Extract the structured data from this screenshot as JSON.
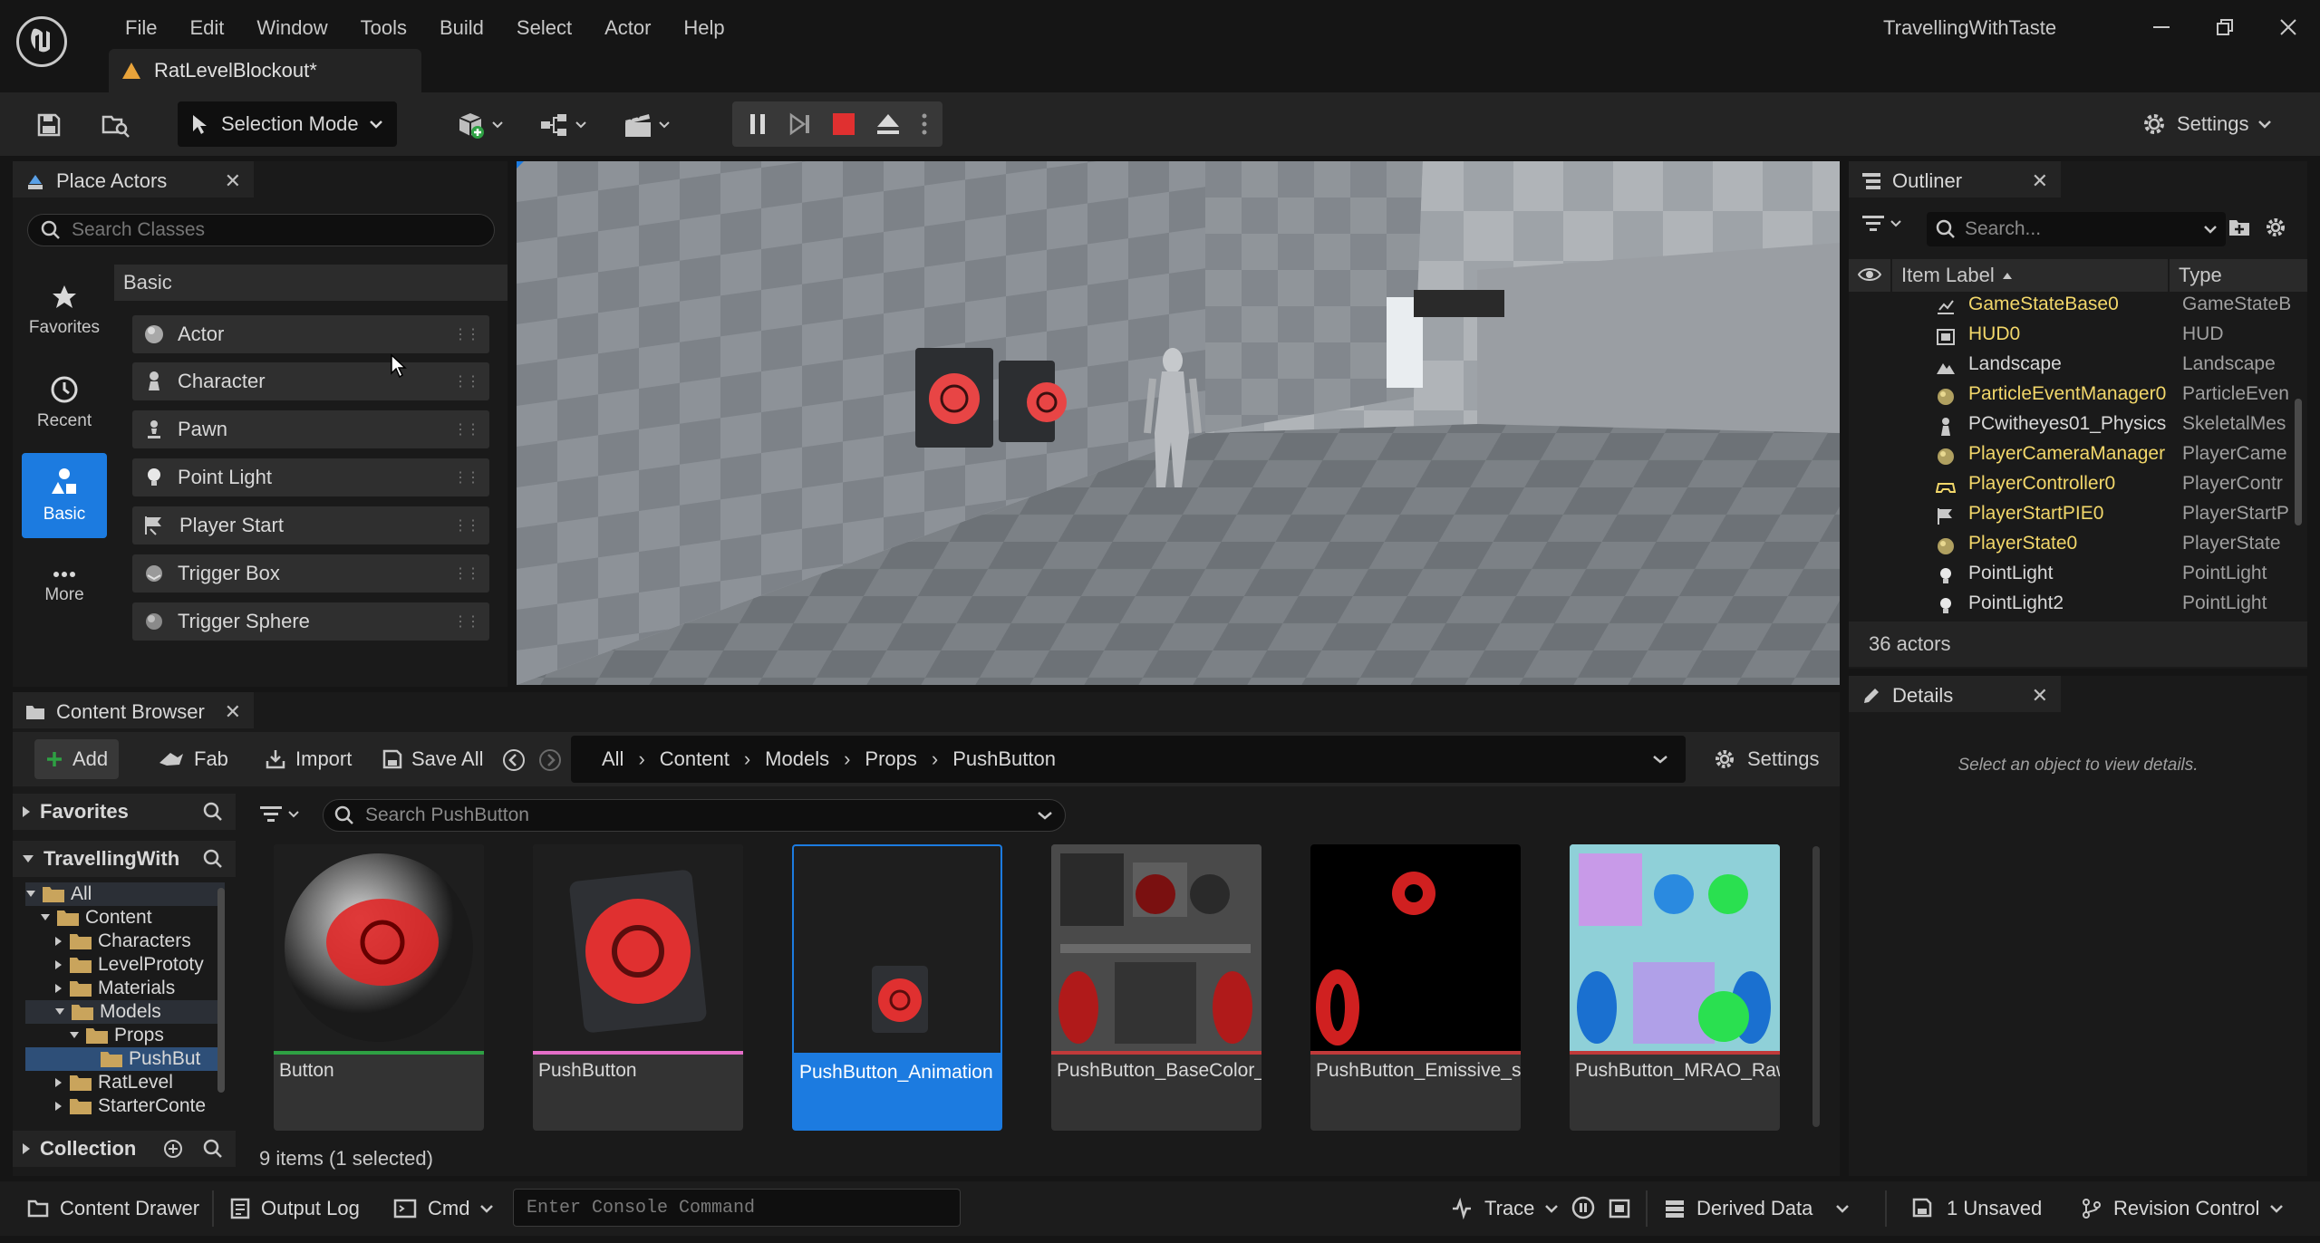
{
  "window": {
    "menu": [
      "File",
      "Edit",
      "Window",
      "Tools",
      "Build",
      "Select",
      "Actor",
      "Help"
    ],
    "project_name": "TravellingWithTaste",
    "document_tab": "RatLevelBlockout*"
  },
  "toolbar": {
    "selection_mode": "Selection Mode",
    "settings_label": "Settings"
  },
  "place_actors": {
    "tab_label": "Place Actors",
    "search_placeholder": "Search Classes",
    "categories": [
      {
        "label": "Favorites",
        "icon": "star-icon"
      },
      {
        "label": "Recent",
        "icon": "clock-icon"
      },
      {
        "label": "Basic",
        "icon": "shapes-icon"
      },
      {
        "label": "More",
        "icon": "more-icon"
      }
    ],
    "section_header": "Basic",
    "actors": [
      {
        "label": "Actor",
        "icon": "sphere-icon"
      },
      {
        "label": "Character",
        "icon": "character-icon"
      },
      {
        "label": "Pawn",
        "icon": "pawn-icon"
      },
      {
        "label": "Point Light",
        "icon": "bulb-icon"
      },
      {
        "label": "Player Start",
        "icon": "flag-icon"
      },
      {
        "label": "Trigger Box",
        "icon": "box-icon"
      },
      {
        "label": "Trigger Sphere",
        "icon": "sphere-icon"
      }
    ]
  },
  "outliner": {
    "tab_label": "Outliner",
    "search_placeholder": "Search...",
    "col_label": "Item Label",
    "col_type": "Type",
    "rows": [
      {
        "label": "GameStateBase0",
        "type": "GameStateB",
        "highlight": true
      },
      {
        "label": "HUD0",
        "type": "HUD",
        "highlight": true
      },
      {
        "label": "Landscape",
        "type": "Landscape",
        "highlight": false
      },
      {
        "label": "ParticleEventManager0",
        "type": "ParticleEven",
        "highlight": true
      },
      {
        "label": "PCwitheyes01_Physics",
        "type": "SkeletalMes",
        "highlight": false
      },
      {
        "label": "PlayerCameraManager",
        "type": "PlayerCame",
        "highlight": true
      },
      {
        "label": "PlayerController0",
        "type": "PlayerContr",
        "highlight": true
      },
      {
        "label": "PlayerStartPIE0",
        "type": "PlayerStartP",
        "highlight": true
      },
      {
        "label": "PlayerState0",
        "type": "PlayerState",
        "highlight": true
      },
      {
        "label": "PointLight",
        "type": "PointLight",
        "highlight": false
      },
      {
        "label": "PointLight2",
        "type": "PointLight",
        "highlight": false
      }
    ],
    "count": "36 actors"
  },
  "details": {
    "tab_label": "Details",
    "empty_text": "Select an object to view details."
  },
  "content_browser": {
    "tab_label": "Content Browser",
    "add_label": "Add",
    "fab_label": "Fab",
    "import_label": "Import",
    "save_all_label": "Save All",
    "breadcrumb": [
      "All",
      "Content",
      "Models",
      "Props",
      "PushButton"
    ],
    "settings_label": "Settings",
    "favorites_label": "Favorites",
    "project_label": "TravellingWith",
    "tree": [
      {
        "label": "All",
        "depth": 0,
        "open": true,
        "selected": false
      },
      {
        "label": "Content",
        "depth": 1,
        "open": true,
        "selected": false
      },
      {
        "label": "Characters",
        "depth": 2,
        "open": false,
        "selected": false
      },
      {
        "label": "LevelPrototy",
        "depth": 2,
        "open": false,
        "selected": false
      },
      {
        "label": "Materials",
        "depth": 2,
        "open": false,
        "selected": false
      },
      {
        "label": "Models",
        "depth": 2,
        "open": true,
        "selected": false
      },
      {
        "label": "Props",
        "depth": 3,
        "open": true,
        "selected": false
      },
      {
        "label": "PushBut",
        "depth": 4,
        "open": false,
        "selected": true
      },
      {
        "label": "RatLevel",
        "depth": 2,
        "open": false,
        "selected": false
      },
      {
        "label": "StarterConte",
        "depth": 2,
        "open": false,
        "selected": false
      }
    ],
    "collections_label": "Collection",
    "search_placeholder": "Search PushButton",
    "assets": [
      {
        "label": "Button",
        "bar_color": "#2ea043",
        "selected": false
      },
      {
        "label": "PushButton",
        "bar_color": "#e46ec8",
        "selected": false
      },
      {
        "label": "PushButton_Animation",
        "bar_color": "#1c7be0",
        "selected": true
      },
      {
        "label": "PushButton_BaseColor_sRGB",
        "bar_color": "#c03a3a",
        "selected": false
      },
      {
        "label": "PushButton_Emissive_sRGB",
        "bar_color": "#c03a3a",
        "selected": false
      },
      {
        "label": "PushButton_MRAO_Raw",
        "bar_color": "#c03a3a",
        "selected": false
      }
    ],
    "count": "9 items (1 selected)"
  },
  "statusbar": {
    "content_drawer": "Content Drawer",
    "output_log": "Output Log",
    "cmd": "Cmd",
    "console_placeholder": "Enter Console Command",
    "trace": "Trace",
    "derived_data": "Derived Data",
    "unsaved": "1 Unsaved",
    "revision_control": "Revision Control"
  },
  "colors": {
    "accent": "#1c7be0",
    "highlight_text": "#f2d76a",
    "play_stop": "#e03030"
  }
}
